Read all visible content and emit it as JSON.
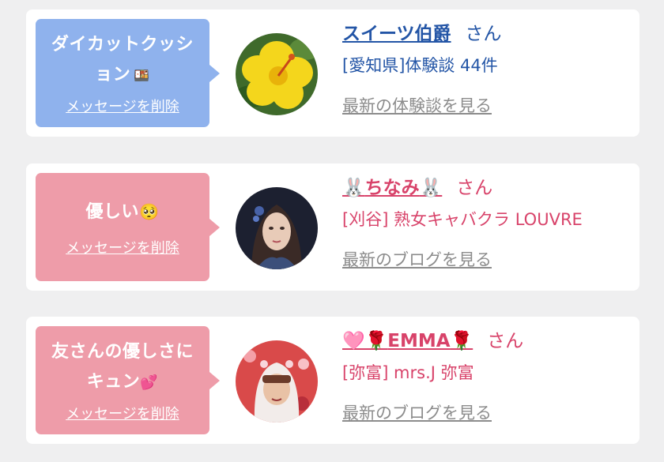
{
  "items": [
    {
      "bubble_text_line1": "ダイカットクッシ",
      "bubble_text_line2": "ョン",
      "bubble_emoji": "🍱",
      "delete_label": "メッセージを削除",
      "name": "スイーツ伯爵",
      "san": "さん",
      "sub": "[愛知県]体験談 44件",
      "latest": "最新の体験談を見る",
      "theme": "#8fb2ed"
    },
    {
      "bubble_text_line1": "優しい",
      "bubble_emoji": "🥺",
      "delete_label": "メッセージを削除",
      "name": "ちなみ",
      "name_emoji": "🐰",
      "san": "さん",
      "sub": "[刈谷] 熟女キャバクラ LOUVRE",
      "latest": "最新のブログを見る",
      "theme": "#ee9ca9"
    },
    {
      "bubble_text_line1": "友さんの優しさに",
      "bubble_text_line2": "キュン",
      "bubble_emoji": "💕",
      "delete_label": "メッセージを削除",
      "name": "EMMA",
      "name_prefix_emoji": "🩷🌹",
      "name_suffix_emoji": "🌹",
      "san": "さん",
      "sub": "[弥富] mrs.J 弥富",
      "latest": "最新のブログを見る",
      "theme": "#ee9ca9"
    }
  ]
}
